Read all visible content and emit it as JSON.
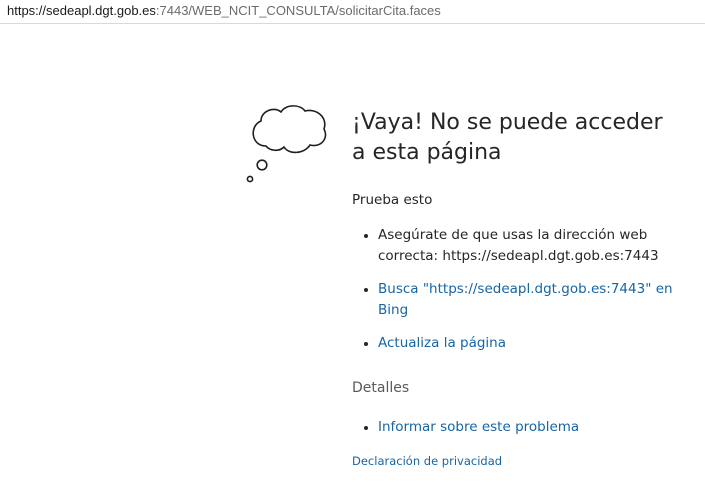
{
  "address_bar": {
    "url_host": "https://sedeapl.dgt.gob.es",
    "url_path": ":7443/WEB_NCIT_CONSULTA/solicitarCita.faces"
  },
  "error": {
    "title": "¡Vaya! No se puede acceder a esta página",
    "subtitle": "Prueba esto",
    "suggestions": [
      {
        "text": "Asegúrate de que usas la dirección web correcta: https://sedeapl.dgt.gob.es:7443"
      },
      {
        "text": "Busca \"https://sedeapl.dgt.gob.es:7443\" en Bing"
      },
      {
        "text": "Actualiza la página"
      }
    ],
    "details_heading": "Detalles",
    "report_link": "Informar sobre este problema",
    "privacy_link": "Declaración de privacidad",
    "icon": "cloud-icon"
  },
  "colors": {
    "link": "#1565a8",
    "text": "#262626",
    "muted": "#5a5a5a"
  }
}
